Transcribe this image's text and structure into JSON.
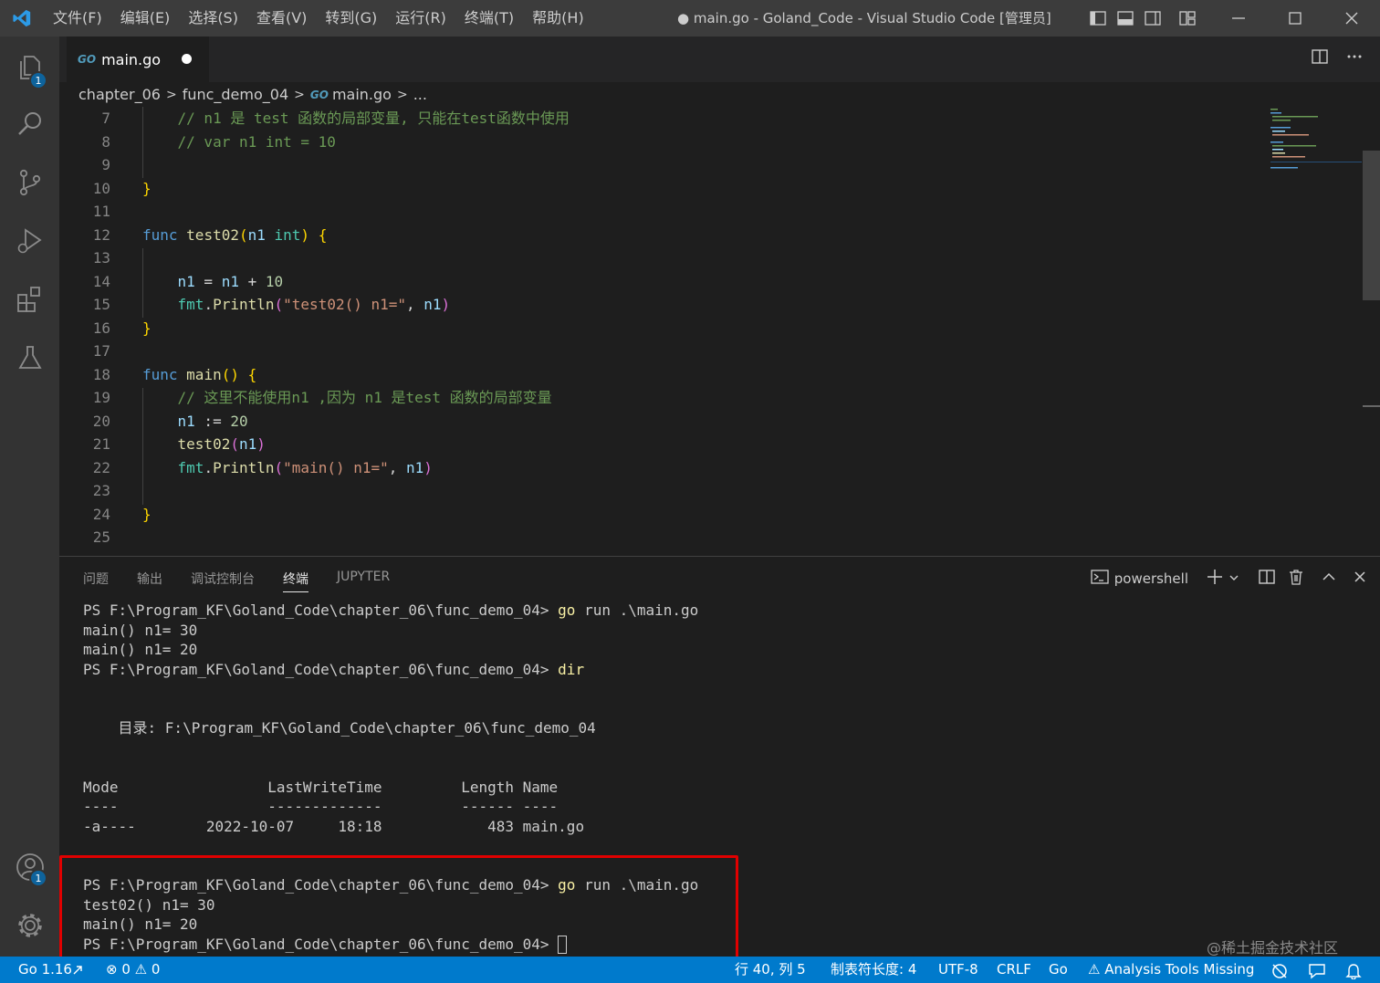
{
  "titlebar": {
    "menu": [
      "文件(F)",
      "编辑(E)",
      "选择(S)",
      "查看(V)",
      "转到(G)",
      "运行(R)",
      "终端(T)",
      "帮助(H)"
    ],
    "title": "● main.go - Goland_Code - Visual Studio Code [管理员]"
  },
  "activity": {
    "explorer_badge": "1",
    "accounts_badge": "1"
  },
  "tabs": {
    "active": {
      "icon_text": "GO",
      "label": "main.go"
    }
  },
  "breadcrumb": {
    "items": [
      "chapter_06",
      "func_demo_04",
      "main.go",
      "..."
    ],
    "file_icon_text": "GO"
  },
  "editor": {
    "line_numbers": [
      "7",
      "8",
      "9",
      "10",
      "11",
      "12",
      "13",
      "14",
      "15",
      "16",
      "17",
      "18",
      "19",
      "20",
      "21",
      "22",
      "23",
      "24",
      "25"
    ],
    "lines": [
      [
        {
          "t": "    "
        },
        {
          "t": "// n1 是 test 函数的局部变量, 只能在test函数中使用",
          "c": "comment"
        }
      ],
      [
        {
          "t": "    "
        },
        {
          "t": "// var n1 int = 10",
          "c": "comment"
        }
      ],
      [
        {
          "t": ""
        }
      ],
      [
        {
          "t": "}",
          "c": "brace"
        }
      ],
      [
        {
          "t": ""
        }
      ],
      [
        {
          "t": "func ",
          "c": "kw"
        },
        {
          "t": "test02",
          "c": "fn"
        },
        {
          "t": "(",
          "c": "brace"
        },
        {
          "t": "n1 ",
          "c": "var"
        },
        {
          "t": "int",
          "c": "type"
        },
        {
          "t": ") {",
          "c": "brace"
        }
      ],
      [
        {
          "t": ""
        }
      ],
      [
        {
          "t": "    "
        },
        {
          "t": "n1",
          "c": "var"
        },
        {
          "t": " = "
        },
        {
          "t": "n1",
          "c": "var"
        },
        {
          "t": " + "
        },
        {
          "t": "10",
          "c": "num"
        }
      ],
      [
        {
          "t": "    "
        },
        {
          "t": "fmt",
          "c": "type"
        },
        {
          "t": "."
        },
        {
          "t": "Println",
          "c": "fn"
        },
        {
          "t": "(",
          "c": "paren"
        },
        {
          "t": "\"test02() n1=\"",
          "c": "str"
        },
        {
          "t": ", "
        },
        {
          "t": "n1",
          "c": "var"
        },
        {
          "t": ")",
          "c": "paren"
        }
      ],
      [
        {
          "t": "}",
          "c": "brace"
        }
      ],
      [
        {
          "t": ""
        }
      ],
      [
        {
          "t": "func ",
          "c": "kw"
        },
        {
          "t": "main",
          "c": "fn"
        },
        {
          "t": "() {",
          "c": "brace"
        }
      ],
      [
        {
          "t": "    "
        },
        {
          "t": "// 这里不能使用n1 ,因为 n1 是test 函数的局部变量",
          "c": "comment"
        }
      ],
      [
        {
          "t": "    "
        },
        {
          "t": "n1",
          "c": "var"
        },
        {
          "t": " := "
        },
        {
          "t": "20",
          "c": "num"
        }
      ],
      [
        {
          "t": "    "
        },
        {
          "t": "test02",
          "c": "fn"
        },
        {
          "t": "(",
          "c": "paren"
        },
        {
          "t": "n1",
          "c": "var"
        },
        {
          "t": ")",
          "c": "paren"
        }
      ],
      [
        {
          "t": "    "
        },
        {
          "t": "fmt",
          "c": "type"
        },
        {
          "t": "."
        },
        {
          "t": "Println",
          "c": "fn"
        },
        {
          "t": "(",
          "c": "paren"
        },
        {
          "t": "\"main() n1=\"",
          "c": "str"
        },
        {
          "t": ", "
        },
        {
          "t": "n1",
          "c": "var"
        },
        {
          "t": ")",
          "c": "paren"
        }
      ],
      [
        {
          "t": ""
        }
      ],
      [
        {
          "t": "}",
          "c": "brace"
        }
      ],
      [
        {
          "t": ""
        }
      ]
    ]
  },
  "panel": {
    "tabs": [
      "问题",
      "输出",
      "调试控制台",
      "终端",
      "JUPYTER"
    ],
    "active_tab": "终端",
    "shell_label": "powershell"
  },
  "terminal": {
    "lines": [
      [
        {
          "t": "PS F:\\Program_KF\\Goland_Code\\chapter_06\\func_demo_04> "
        },
        {
          "t": "go",
          "c": "cmd"
        },
        {
          "t": " run .\\main.go"
        }
      ],
      [
        {
          "t": "main() n1= 30"
        }
      ],
      [
        {
          "t": "main() n1= 20"
        }
      ],
      [
        {
          "t": "PS F:\\Program_KF\\Goland_Code\\chapter_06\\func_demo_04> "
        },
        {
          "t": "dir",
          "c": "cmd"
        }
      ],
      [
        {
          "t": ""
        }
      ],
      [
        {
          "t": ""
        }
      ],
      [
        {
          "t": "    目录: F:\\Program_KF\\Goland_Code\\chapter_06\\func_demo_04"
        }
      ],
      [
        {
          "t": ""
        }
      ],
      [
        {
          "t": ""
        }
      ],
      [
        {
          "t": "Mode                 LastWriteTime         Length Name"
        }
      ],
      [
        {
          "t": "----                 -------------         ------ ----"
        }
      ],
      [
        {
          "t": "-a----        2022-10-07     18:18            483 main.go"
        }
      ],
      [
        {
          "t": ""
        }
      ],
      [
        {
          "t": ""
        }
      ],
      [
        {
          "t": "PS F:\\Program_KF\\Goland_Code\\chapter_06\\func_demo_04> "
        },
        {
          "t": "go",
          "c": "cmd"
        },
        {
          "t": " run .\\main.go"
        }
      ],
      [
        {
          "t": "test02() n1= 30"
        }
      ],
      [
        {
          "t": "main() n1= 20"
        }
      ],
      [
        {
          "t": "PS F:\\Program_KF\\Goland_Code\\chapter_06\\func_demo_04> "
        },
        {
          "t": "",
          "c": "cursor"
        }
      ]
    ]
  },
  "statusbar": {
    "go_version": "Go 1.16",
    "problems": "⊗ 0 ⚠ 0",
    "position": "行 40, 列 5",
    "indent": "制表符长度: 4",
    "encoding": "UTF-8",
    "eol": "CRLF",
    "language": "Go",
    "analysis": "⚠ Analysis Tools Missing"
  },
  "watermark": "@稀土掘金技术社区",
  "colors": {
    "accent": "#007acc",
    "highlight_box": "#e00000"
  }
}
